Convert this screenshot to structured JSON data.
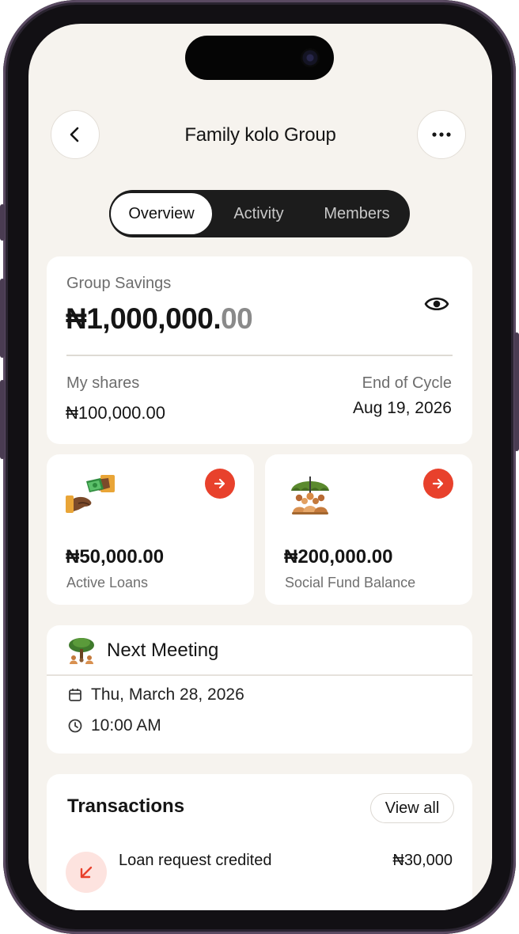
{
  "header": {
    "title": "Family kolo Group"
  },
  "tabs": [
    {
      "label": "Overview",
      "active": true
    },
    {
      "label": "Activity",
      "active": false
    },
    {
      "label": "Members",
      "active": false
    }
  ],
  "savings": {
    "label": "Group Savings",
    "amount_main": "₦1,000,000.",
    "amount_decimal": "00",
    "my_shares_label": "My shares",
    "my_shares_value": "₦100,000.00",
    "end_cycle_label": "End of Cycle",
    "end_cycle_value": "Aug 19, 2026"
  },
  "stats": [
    {
      "amount": "₦50,000.00",
      "label": "Active Loans",
      "icon": "money-hand-icon"
    },
    {
      "amount": "₦200,000.00",
      "label": "Social Fund Balance",
      "icon": "umbrella-people-icon"
    }
  ],
  "meeting": {
    "title": "Next Meeting",
    "date": "Thu, March 28, 2026",
    "time": "10:00 AM"
  },
  "transactions": {
    "title": "Transactions",
    "view_all": "View all",
    "items": [
      {
        "title": "Loan request credited",
        "amount": "₦30,000"
      }
    ]
  },
  "colors": {
    "accent_red": "#e8412c",
    "background": "#f6f3ee",
    "dark": "#1c1c1c"
  }
}
